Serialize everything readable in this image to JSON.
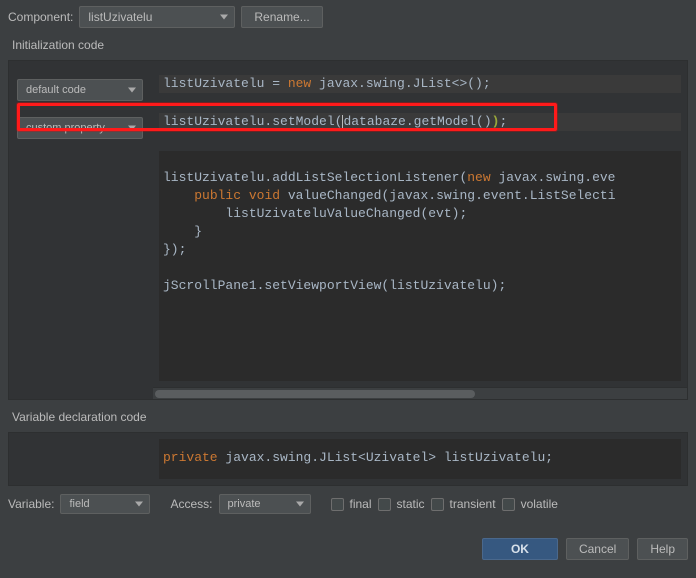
{
  "top": {
    "component_label": "Component:",
    "component_value": "listUzivatelu",
    "rename_label": "Rename..."
  },
  "init": {
    "title": "Initialization code",
    "dropdown1": "default code",
    "dropdown2": "custom property",
    "line1_pre": "listUzivatelu = ",
    "line1_kw": "new",
    "line1_post": " javax.swing.JList<>();",
    "line2_a": "listUzivatelu.setModel(",
    "line2_b": "databaze.getModel()",
    "line2_c": ");",
    "block_l1_a": "listUzivatelu.addListSelectionListener(",
    "block_l1_kw": "new",
    "block_l1_b": " javax.swing.eve",
    "block_l2_a": "    ",
    "block_l2_kw1": "public",
    "block_l2_sp": " ",
    "block_l2_kw2": "void",
    "block_l2_b": " valueChanged(javax.swing.event.ListSelecti",
    "block_l3": "        listUzivateluValueChanged(evt);",
    "block_l4": "    }",
    "block_l5": "});",
    "block_l7": "jScrollPane1.setViewportView(listUzivatelu);"
  },
  "vardecl": {
    "title": "Variable declaration code",
    "kw": "private",
    "rest": " javax.swing.JList<Uzivatel> listUzivatelu;"
  },
  "footer": {
    "variable_label": "Variable:",
    "variable_value": "field",
    "access_label": "Access:",
    "access_value": "private",
    "final": "final",
    "static": "static",
    "transient": "transient",
    "volatile": "volatile"
  },
  "buttons": {
    "ok": "OK",
    "cancel": "Cancel",
    "help": "Help"
  }
}
